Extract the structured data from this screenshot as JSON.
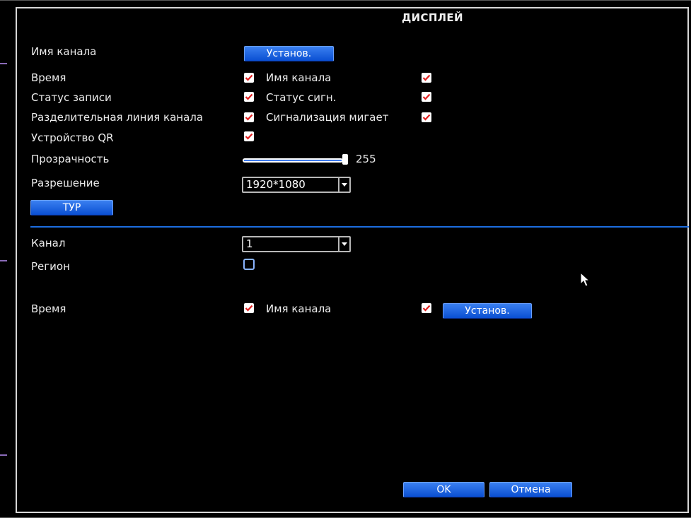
{
  "title": "ДИСПЛЕЙ",
  "top_section": {
    "channel_name_label": "Имя канала",
    "channel_name_button": "Установ.",
    "time_label": "Время",
    "time_checked": true,
    "record_status_label": "Статус записи",
    "record_status_checked": true,
    "divider_line_label": "Разделительная линия канала",
    "divider_line_checked": true,
    "qr_label": "Устройство QR",
    "qr_checked": true,
    "channel_name_cb_label": "Имя канала",
    "channel_name_cb_checked": true,
    "alarm_status_label": "Статус сигн.",
    "alarm_status_checked": true,
    "alarm_blink_label": "Сигнализация мигает",
    "alarm_blink_checked": true,
    "transparency_label": "Прозрачность",
    "transparency_value": "255",
    "resolution_label": "Разрешение",
    "resolution_value": "1920*1080",
    "tour_button": "ТУР"
  },
  "bottom_section": {
    "channel_label": "Канал",
    "channel_value": "1",
    "region_label": "Регион",
    "region_checked": false,
    "time_label": "Время",
    "time_checked": true,
    "channel_name_label": "Имя канала",
    "channel_name_checked": true,
    "set_button": "Установ."
  },
  "footer": {
    "ok_button": "OK",
    "cancel_button": "Отмена"
  },
  "colors": {
    "accent": "#1d6de0",
    "button": "#0a4fd2",
    "check": "#e02020"
  }
}
